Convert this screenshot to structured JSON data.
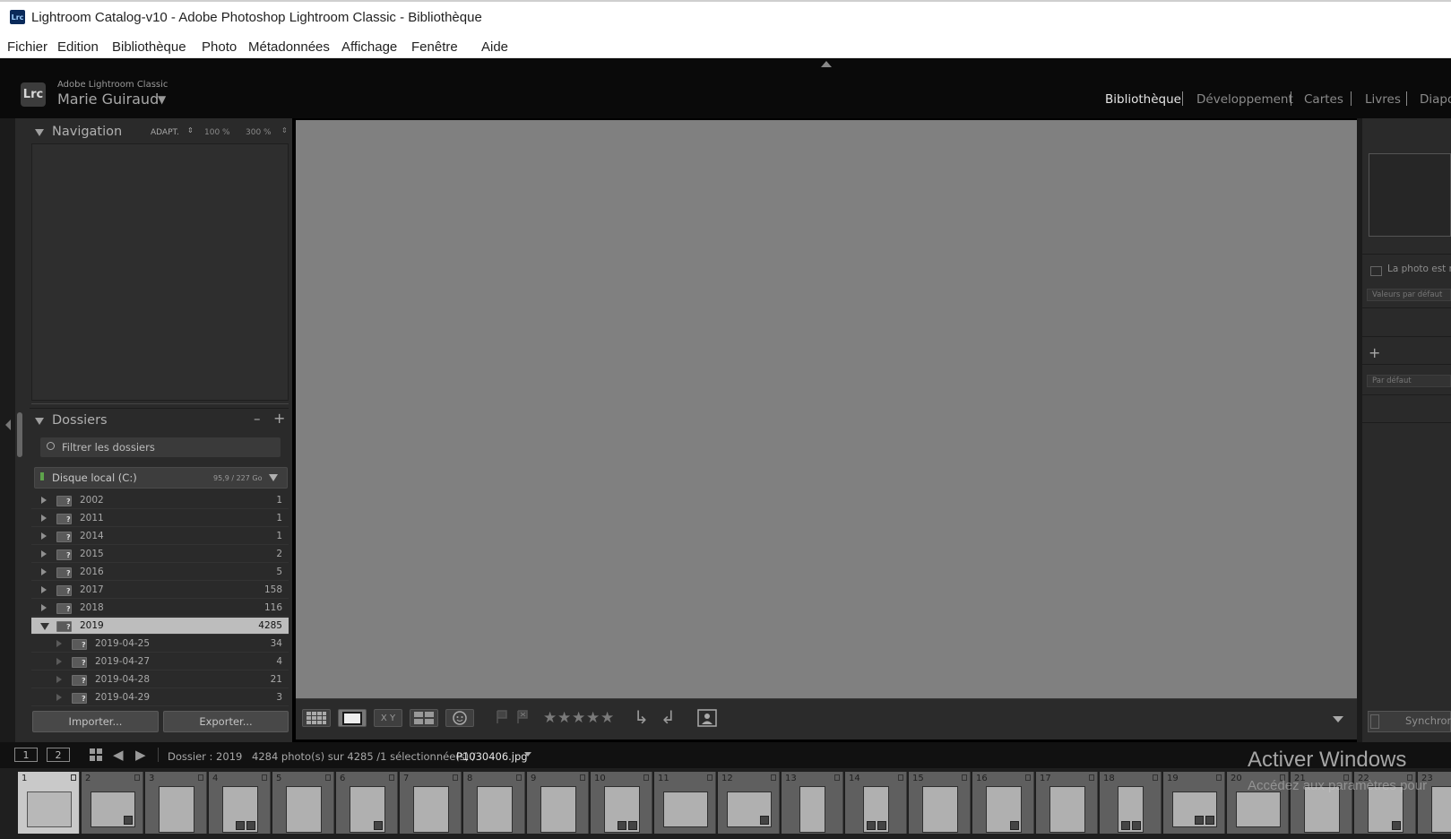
{
  "window": {
    "app_icon": "Lrc",
    "title": "Lightroom Catalog-v10 - Adobe Photoshop Lightroom Classic - Bibliothèque"
  },
  "menu": [
    "Fichier",
    "Edition",
    "Bibliothèque",
    "Photo",
    "Métadonnées",
    "Affichage",
    "Fenêtre",
    "Aide"
  ],
  "identity": {
    "logo": "Lrc",
    "product": "Adobe Lightroom Classic",
    "user": "Marie Guiraud",
    "dropdown": "▼"
  },
  "modules": [
    {
      "label": "Bibliothèque",
      "active": true
    },
    {
      "label": "Développement",
      "active": false
    },
    {
      "label": "Cartes",
      "active": false
    },
    {
      "label": "Livres",
      "active": false
    },
    {
      "label": "Diapo",
      "active": false
    }
  ],
  "navigator": {
    "title": "Navigation",
    "zoom_fit": "ADAPT.",
    "zoom_100": "100 %",
    "zoom_300": "300 %"
  },
  "folders": {
    "title": "Dossiers",
    "minus": "–",
    "plus": "+",
    "filter_placeholder": "Filtrer les dossiers",
    "volume_name": "Disque local (C:)",
    "volume_size": "95,9 / 227 Go",
    "rows": [
      {
        "name": "2002",
        "count": "1",
        "level": 0,
        "expanded": false,
        "selected": false
      },
      {
        "name": "2011",
        "count": "1",
        "level": 0,
        "expanded": false,
        "selected": false
      },
      {
        "name": "2014",
        "count": "1",
        "level": 0,
        "expanded": false,
        "selected": false
      },
      {
        "name": "2015",
        "count": "2",
        "level": 0,
        "expanded": false,
        "selected": false
      },
      {
        "name": "2016",
        "count": "5",
        "level": 0,
        "expanded": false,
        "selected": false
      },
      {
        "name": "2017",
        "count": "158",
        "level": 0,
        "expanded": false,
        "selected": false
      },
      {
        "name": "2018",
        "count": "116",
        "level": 0,
        "expanded": false,
        "selected": false
      },
      {
        "name": "2019",
        "count": "4285",
        "level": 0,
        "expanded": true,
        "selected": true
      },
      {
        "name": "2019-04-25",
        "count": "34",
        "level": 1,
        "expanded": false,
        "selected": false
      },
      {
        "name": "2019-04-27",
        "count": "4",
        "level": 1,
        "expanded": false,
        "selected": false
      },
      {
        "name": "2019-04-28",
        "count": "21",
        "level": 1,
        "expanded": false,
        "selected": false
      },
      {
        "name": "2019-04-29",
        "count": "3",
        "level": 1,
        "expanded": false,
        "selected": false
      }
    ]
  },
  "left_buttons": {
    "import": "Importer...",
    "export": "Exporter..."
  },
  "toolbar": {
    "compare_label": "X Y",
    "stars": [
      "★",
      "★",
      "★",
      "★",
      "★"
    ]
  },
  "right_panel": {
    "photo_notice": "La photo est m",
    "default_value": "Valeurs par défaut",
    "plus": "+",
    "preset": "Par défaut",
    "sync": "Synchron"
  },
  "filmstrip_header": {
    "screen1": "1",
    "screen2": "2",
    "source_label": "Dossier : 2019",
    "source_count": "4284 photo(s) sur 4285 /1 sélectionnée(s) /",
    "source_file": "P1030406.jpg"
  },
  "filmstrip": [
    {
      "n": "1",
      "orient": "landscape",
      "selected": true,
      "marks": 0
    },
    {
      "n": "2",
      "orient": "landscape",
      "selected": false,
      "marks": 1
    },
    {
      "n": "3",
      "orient": "portrait",
      "selected": false,
      "marks": 0
    },
    {
      "n": "4",
      "orient": "portrait",
      "selected": false,
      "marks": 2
    },
    {
      "n": "5",
      "orient": "portrait",
      "selected": false,
      "marks": 0
    },
    {
      "n": "6",
      "orient": "portrait",
      "selected": false,
      "marks": 1
    },
    {
      "n": "7",
      "orient": "portrait",
      "selected": false,
      "marks": 0
    },
    {
      "n": "8",
      "orient": "portrait",
      "selected": false,
      "marks": 0
    },
    {
      "n": "9",
      "orient": "portrait",
      "selected": false,
      "marks": 0
    },
    {
      "n": "10",
      "orient": "portrait",
      "selected": false,
      "marks": 2
    },
    {
      "n": "11",
      "orient": "landscape",
      "selected": false,
      "marks": 0
    },
    {
      "n": "12",
      "orient": "landscape",
      "selected": false,
      "marks": 1
    },
    {
      "n": "13",
      "orient": "narrow",
      "selected": false,
      "marks": 0
    },
    {
      "n": "14",
      "orient": "narrow",
      "selected": false,
      "marks": 2
    },
    {
      "n": "15",
      "orient": "portrait",
      "selected": false,
      "marks": 0
    },
    {
      "n": "16",
      "orient": "portrait",
      "selected": false,
      "marks": 1
    },
    {
      "n": "17",
      "orient": "portrait",
      "selected": false,
      "marks": 0
    },
    {
      "n": "18",
      "orient": "narrow",
      "selected": false,
      "marks": 2
    },
    {
      "n": "19",
      "orient": "landscape",
      "selected": false,
      "marks": 2
    },
    {
      "n": "20",
      "orient": "landscape",
      "selected": false,
      "marks": 0
    },
    {
      "n": "21",
      "orient": "portrait",
      "selected": false,
      "marks": 0
    },
    {
      "n": "22",
      "orient": "portrait",
      "selected": false,
      "marks": 1
    },
    {
      "n": "23",
      "orient": "portrait",
      "selected": false,
      "marks": 0
    }
  ],
  "watermark": {
    "line1": "Activer Windows",
    "line2": "Accédez aux paramètres pour"
  }
}
